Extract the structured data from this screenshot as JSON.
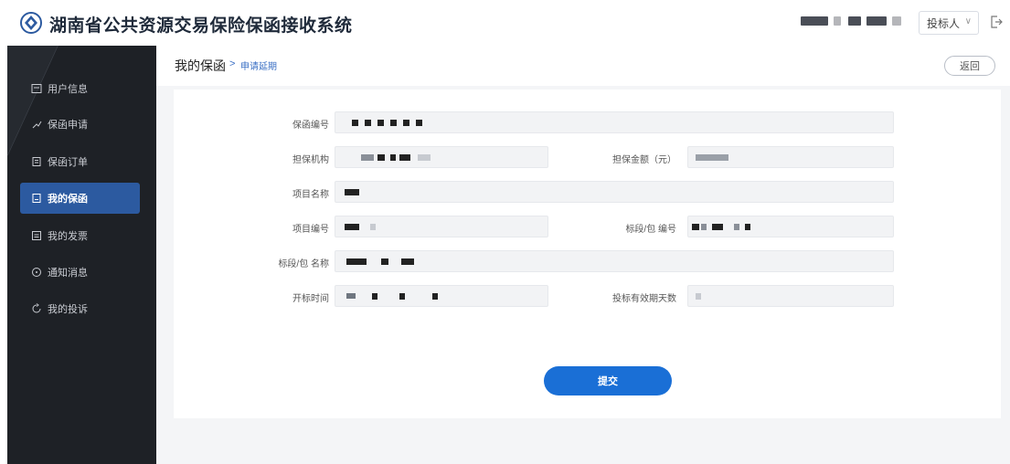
{
  "header": {
    "title": "湖南省公共资源交易保险保函接收系统",
    "role_select": "投标人",
    "role_chevron": "∨"
  },
  "sidebar": {
    "items": [
      {
        "label": "用户信息",
        "icon": "user-card-icon"
      },
      {
        "label": "保函申请",
        "icon": "apply-icon"
      },
      {
        "label": "保函订单",
        "icon": "order-icon"
      },
      {
        "label": "我的保函",
        "icon": "document-icon",
        "active": true
      },
      {
        "label": "我的发票",
        "icon": "invoice-icon"
      },
      {
        "label": "通知消息",
        "icon": "message-icon"
      },
      {
        "label": "我的投诉",
        "icon": "complaint-icon"
      }
    ]
  },
  "breadcrumb": {
    "main": "我的保函",
    "separator": ">",
    "sub": "申请延期"
  },
  "back_label": "返回",
  "form": {
    "guarantee_no_label": "保函编号",
    "guarantee_org_label": "担保机构",
    "guarantee_amount_label": "担保金额（元）",
    "project_name_label": "项目名称",
    "project_no_label": "项目编号",
    "section_no_label": "标段/包 编号",
    "section_name_label": "标段/包 名称",
    "open_time_label": "开标时间",
    "valid_days_label": "投标有效期天数"
  },
  "submit_label": "提交",
  "colors": {
    "sidebar_bg": "#1e2126",
    "active_item": "#2c5aa0",
    "primary_button": "#1a6fd6",
    "link": "#3a6fc4"
  }
}
